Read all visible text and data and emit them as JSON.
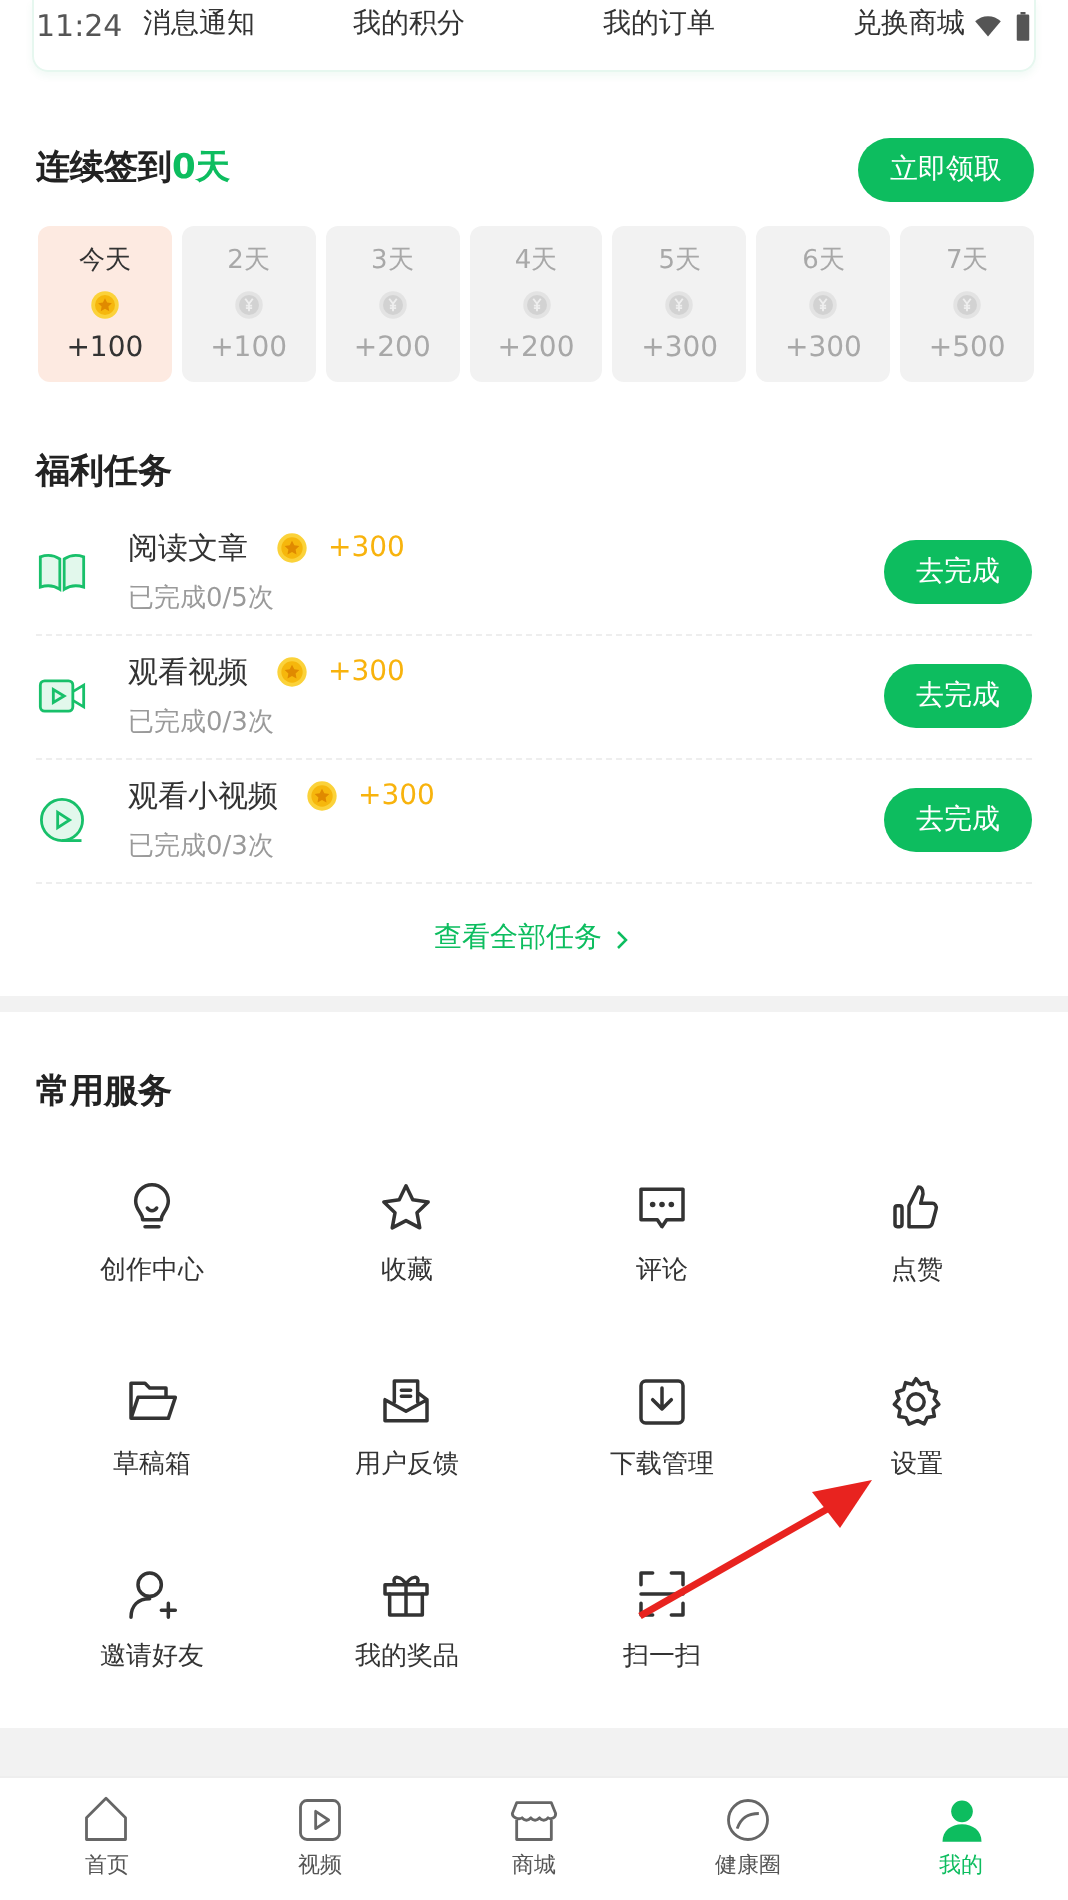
{
  "status_bar": {
    "time": "11:24"
  },
  "header_links": [
    "消息通知",
    "我的积分",
    "我的订单",
    "兑换商城"
  ],
  "checkin": {
    "title": "连续签到",
    "streak": "0天",
    "button": "立即领取",
    "days": [
      {
        "label": "今天",
        "reward": "+100",
        "selected": true
      },
      {
        "label": "2天",
        "reward": "+100",
        "selected": false
      },
      {
        "label": "3天",
        "reward": "+200",
        "selected": false
      },
      {
        "label": "4天",
        "reward": "+200",
        "selected": false
      },
      {
        "label": "5天",
        "reward": "+300",
        "selected": false
      },
      {
        "label": "6天",
        "reward": "+300",
        "selected": false
      },
      {
        "label": "7天",
        "reward": "+500",
        "selected": false
      }
    ]
  },
  "tasks": {
    "title": "福利任务",
    "items": [
      {
        "kind": "article",
        "name": "阅读文章",
        "reward": "+300",
        "progress": "已完成0/5次",
        "button": "去完成"
      },
      {
        "kind": "video",
        "name": "观看视频",
        "reward": "+300",
        "progress": "已完成0/3次",
        "button": "去完成"
      },
      {
        "kind": "clip",
        "name": "观看小视频",
        "reward": "+300",
        "progress": "已完成0/3次",
        "button": "去完成"
      }
    ],
    "more": "查看全部任务"
  },
  "services": {
    "title": "常用服务",
    "items": [
      {
        "kind": "bulb",
        "label": "创作中心"
      },
      {
        "kind": "star",
        "label": "收藏"
      },
      {
        "kind": "comment",
        "label": "评论"
      },
      {
        "kind": "like",
        "label": "点赞"
      },
      {
        "kind": "folder",
        "label": "草稿箱"
      },
      {
        "kind": "mail",
        "label": "用户反馈"
      },
      {
        "kind": "download",
        "label": "下载管理"
      },
      {
        "kind": "gear",
        "label": "设置"
      },
      {
        "kind": "invite",
        "label": "邀请好友"
      },
      {
        "kind": "gift",
        "label": "我的奖品"
      },
      {
        "kind": "scan",
        "label": "扫一扫"
      }
    ]
  },
  "tabs": [
    {
      "kind": "home",
      "label": "首页",
      "selected": false
    },
    {
      "kind": "video",
      "label": "视频",
      "selected": false
    },
    {
      "kind": "shop",
      "label": "商城",
      "selected": false
    },
    {
      "kind": "circle",
      "label": "健康圈",
      "selected": false
    },
    {
      "kind": "me",
      "label": "我的",
      "selected": true
    }
  ]
}
